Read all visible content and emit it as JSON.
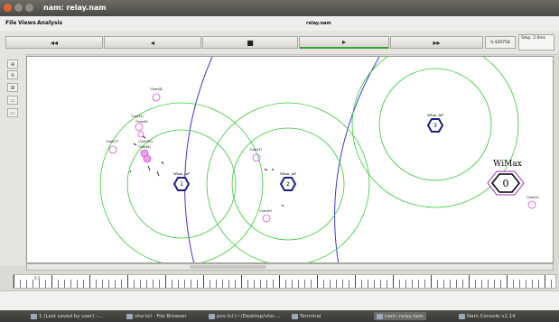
{
  "window": {
    "title": "nam: relay.nam"
  },
  "menu": {
    "items": [
      "File",
      "Views",
      "Analysis"
    ],
    "file_name": "relay.nam"
  },
  "controls": {
    "rewind": "◂◂",
    "back": "◂",
    "stop": "■",
    "play": "▸",
    "forward": "▸▸",
    "time": "0.429758",
    "step_line1": "Step: 2.0ms"
  },
  "tools": [
    "⊕",
    "⊖",
    "⊞",
    "▭",
    "▭"
  ],
  "canvas": {
    "access_points": [
      {
        "label": "Wlan_AP",
        "id": "1"
      },
      {
        "label": "Wlan_AP",
        "id": "2"
      },
      {
        "label": "Wlan_AP",
        "id": "3"
      }
    ],
    "wimax": {
      "label": "WiMax",
      "id": "0"
    },
    "users": [
      {
        "label": "User(4)"
      },
      {
        "label": "User(5)"
      },
      {
        "label": "User(6)"
      },
      {
        "label": "User(7)"
      },
      {
        "label": "User(8)"
      },
      {
        "label": "User(10)"
      },
      {
        "label": "User(3)"
      },
      {
        "label": "User(9)"
      },
      {
        "label": "User(2)"
      }
    ]
  },
  "timeline": {
    "label": "0.5"
  },
  "taskbar": {
    "items": [
      "1 (Last saved by user) -...",
      "vho-tcl - File Browser",
      "pos.tcl (~/Desktop/vho-...",
      "Terminal",
      "nam: relay.nam",
      "Nam Console v1.14"
    ]
  }
}
